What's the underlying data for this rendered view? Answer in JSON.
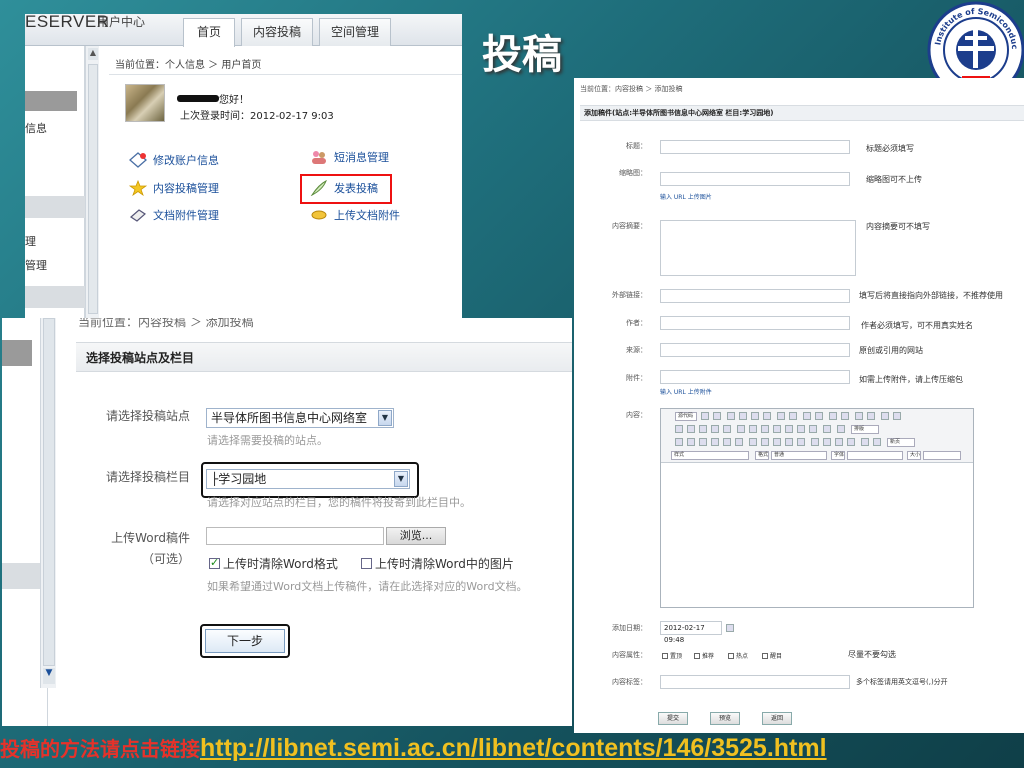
{
  "slide": {
    "title": "投稿",
    "bottom_lead": "投稿的方法请点击链接",
    "bottom_url": "http://libnet.semi.ac.cn/libnet/contents/146/3525.html"
  },
  "logo": {
    "text": "Institute of Semiconductors CAS",
    "year": "1960"
  },
  "panel_user": {
    "brand": "ESERVER",
    "brand_sub": "用户中心",
    "tabs": [
      "首页",
      "内容投稿",
      "空间管理"
    ],
    "left_nav": [
      "信息",
      "理",
      "管理"
    ],
    "breadcrumb": "当前位置：个人信息 ＞ 用户首页",
    "greeting": "您好！",
    "last_login": "上次登录时间：2012-02-17 9:03",
    "actions": {
      "edit_account": "修改账户信息",
      "messages": "短消息管理",
      "content_manage": "内容投稿管理",
      "publish": "发表投稿",
      "doc_attach": "文档附件管理",
      "upload_attach": "上传文档附件"
    }
  },
  "panel_step": {
    "breadcrumb": "当前位置：内容投稿 ＞ 添加投稿",
    "header": "选择投稿站点及栏目",
    "site_label": "请选择投稿站点",
    "site_value": "半导体所图书信息中心网络室",
    "site_hint": "请选择需要投稿的站点。",
    "column_label": "请选择投稿栏目",
    "column_value": "├学习园地",
    "column_hint": "请选择对应站点的栏目，您的稿件将投寄到此栏目中。",
    "upload_label": "上传Word稿件",
    "upload_optional": "（可选）",
    "browse_label": "浏览...",
    "clear_format_label": "上传时清除Word格式",
    "clear_format_checked": true,
    "clear_images_label": "上传时清除Word中的图片",
    "clear_images_checked": false,
    "upload_hint": "如果希望通过Word文档上传稿件，请在此选择对应的Word文档。",
    "next_label": "下一步"
  },
  "panel_form": {
    "breadcrumb": "当前位置：内容投稿 ＞ 添加投稿",
    "header": "添加稿件(站点:半导体所图书信息中心网络室  栏目:学习园地)",
    "fields": {
      "title_label": "标题：",
      "title_note": "标题必须填写",
      "thumb_label": "缩略图：",
      "thumb_note": "缩略图可不上传",
      "thumb_links": "输入 URL    上传图片",
      "summary_label": "内容摘要：",
      "summary_note": "内容摘要可不填写",
      "external_label": "外部链接：",
      "external_note": "填写后将直接指向外部链接，不推荐使用",
      "author_label": "作者：",
      "author_note": "作者必须填写，可不用真实姓名",
      "source_label": "来源：",
      "source_note": "原创或引用的网站",
      "attach_label": "附件：",
      "attach_note": "如需上传附件，请上传压缩包",
      "attach_links": "输入 URL    上传附件",
      "content_label": "内容：",
      "date_label": "添加日期：",
      "date_value": "2012-02-17 09:48",
      "attr_label": "内容属性：",
      "attr_options": [
        "置顶",
        "推荐",
        "热点",
        "醒目"
      ],
      "attr_note": "尽量不要勾选",
      "tags_label": "内容标签：",
      "tags_note": "多个标签请用英文逗号(,)分开"
    },
    "editor": {
      "source_label": "源代码",
      "style_label": "样式",
      "format_label": "格式",
      "format_value": "普通",
      "font_label": "字体",
      "size_label": "大小",
      "typeset_label": "排版",
      "newpage_label": "新页"
    },
    "buttons": [
      "提交",
      "预览",
      "返回"
    ]
  },
  "colors": {
    "background": "#1f6f7c",
    "highlight_red": "#e11111",
    "link_blue": "#1a4f9a",
    "banner_lead": "#e6322a",
    "banner_url": "#f0c020"
  }
}
